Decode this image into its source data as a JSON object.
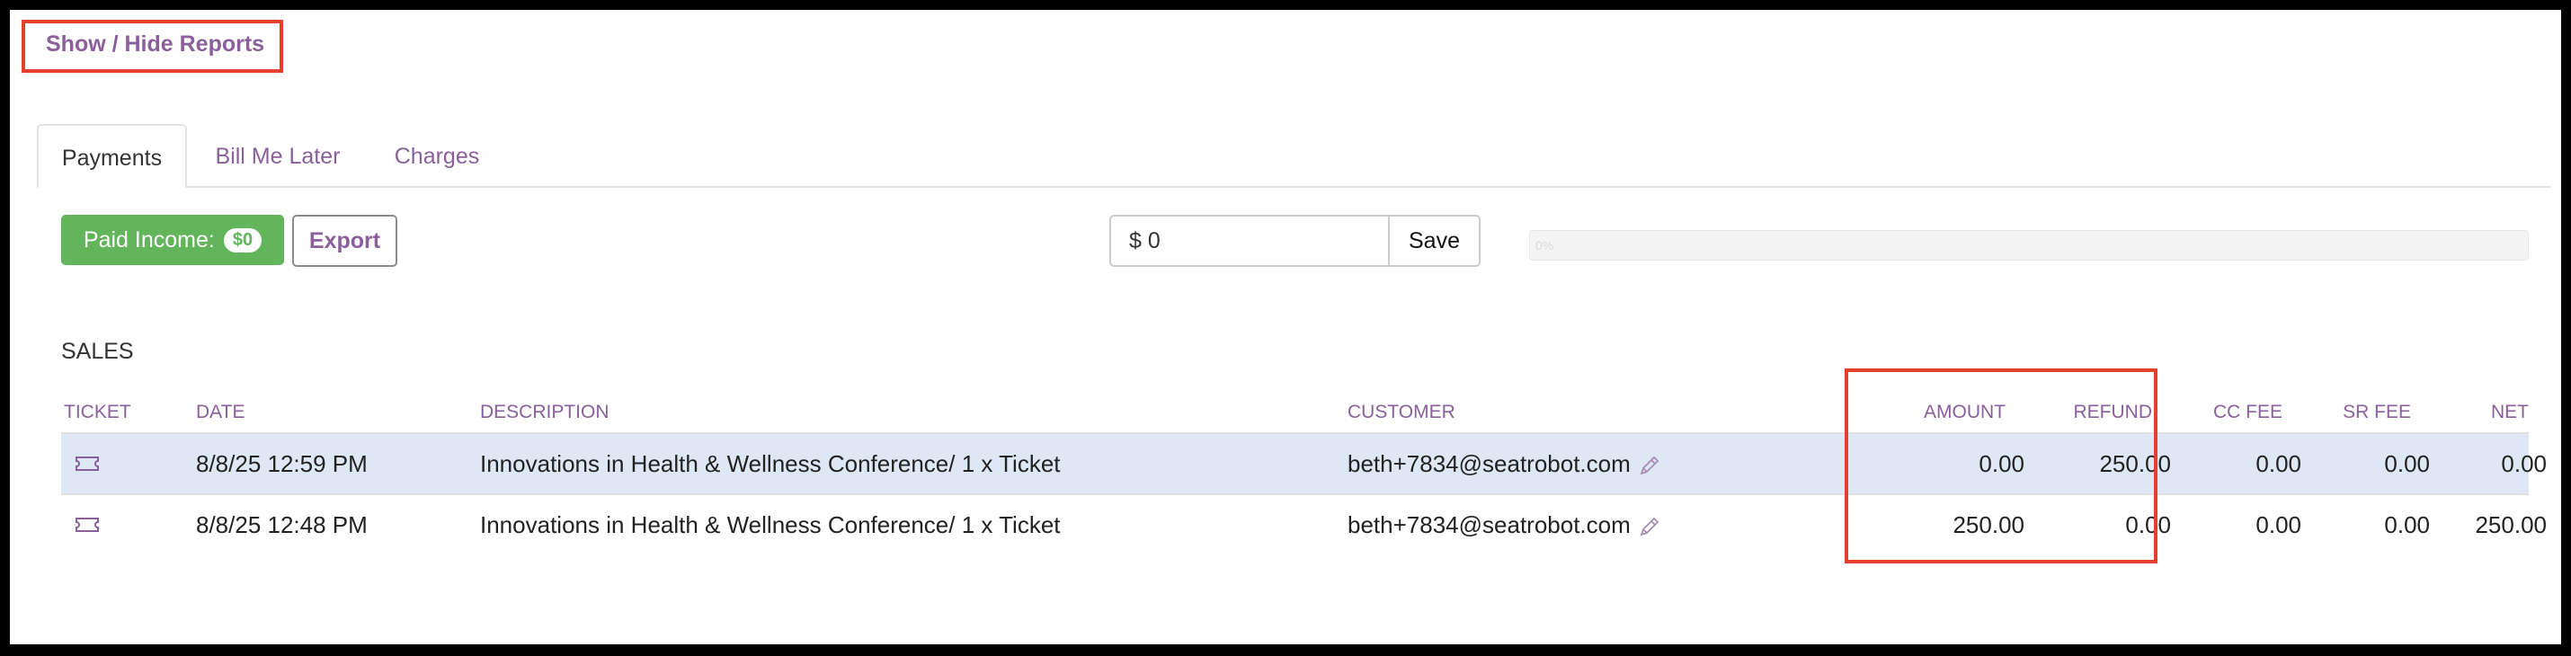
{
  "header": {
    "toggle_reports_label": "Show / Hide Reports"
  },
  "tabs": [
    {
      "label": "Payments",
      "active": true
    },
    {
      "label": "Bill Me Later",
      "active": false
    },
    {
      "label": "Charges",
      "active": false
    }
  ],
  "toolbar": {
    "paid_income_label": "Paid Income:",
    "paid_income_badge": "$0",
    "export_label": "Export",
    "amount_value": "$ 0",
    "save_label": "Save",
    "progress_text": "0%",
    "progress_fraction": 0
  },
  "sales": {
    "title": "SALES",
    "columns": [
      "TICKET",
      "DATE",
      "DESCRIPTION",
      "CUSTOMER",
      "AMOUNT",
      "REFUND",
      "CC FEE",
      "SR FEE",
      "NET"
    ],
    "rows": [
      {
        "icon": "ticket-icon",
        "date": "8/8/25 12:59 PM",
        "description": "Innovations in Health & Wellness Conference/ 1 x Ticket",
        "customer": "beth+7834@seatrobot.com",
        "amount": "0.00",
        "refund": "250.00",
        "cc_fee": "0.00",
        "sr_fee": "0.00",
        "net": "0.00",
        "highlighted": true
      },
      {
        "icon": "ticket-icon",
        "date": "8/8/25 12:48 PM",
        "description": "Innovations in Health & Wellness Conference/ 1 x Ticket",
        "customer": "beth+7834@seatrobot.com",
        "amount": "250.00",
        "refund": "0.00",
        "cc_fee": "0.00",
        "sr_fee": "0.00",
        "net": "250.00",
        "highlighted": false
      }
    ]
  },
  "colors": {
    "accent": "#8a5f9b",
    "success": "#62b55b",
    "annotation": "#e2412c",
    "row_highlight": "#dde8f4"
  }
}
